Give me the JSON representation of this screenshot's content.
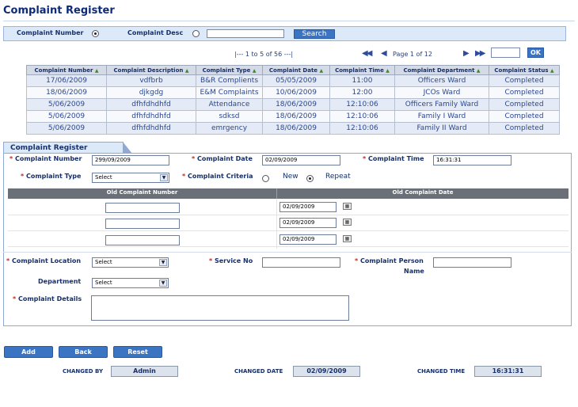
{
  "page": {
    "title": "Complaint Register"
  },
  "search": {
    "label_number": "Complaint Number",
    "label_desc": "Complaint Desc",
    "selected": "number",
    "input_value": "",
    "button_label": "Search"
  },
  "pager": {
    "range_text": "|--- 1    to    5    of    56 ---|",
    "first_icon": "first-page-icon",
    "prev_icon": "prev-page-icon",
    "page_text": "Page 1 of 12",
    "next_icon": "next-page-icon",
    "last_icon": "last-page-icon",
    "goto_value": "",
    "ok_label": "OK"
  },
  "grid": {
    "columns": [
      "Complaint Number",
      "Complaint Description",
      "Complaint Type",
      "Complaint Date",
      "Complaint Time",
      "Complaint Department",
      "Complaint Status"
    ],
    "rows": [
      [
        "17/06/2009",
        "vdfbrb",
        "B&R Complients",
        "05/05/2009",
        "11:00",
        "Officers Ward",
        "Completed"
      ],
      [
        "18/06/2009",
        "djkgdg",
        "E&M Complaints",
        "10/06/2009",
        "12:00",
        "JCOs Ward",
        "Completed"
      ],
      [
        "5/06/2009",
        "dfhfdhdhfd",
        "Attendance",
        "18/06/2009",
        "12:10:06",
        "Officers Family Ward",
        "Completed"
      ],
      [
        "5/06/2009",
        "dfhfdhdhfd",
        "sdksd",
        "18/06/2009",
        "12:10:06",
        "Family I Ward",
        "Completed"
      ],
      [
        "5/06/2009",
        "dfhfdhdhfd",
        "emrgency",
        "18/06/2009",
        "12:10:06",
        "Family II Ward",
        "Completed"
      ]
    ]
  },
  "form": {
    "tab_label": "Complaint Register",
    "complaint_number_label": "Complaint Number",
    "complaint_number_value": "299/09/2009",
    "complaint_date_label": "Complaint Date",
    "complaint_date_value": "02/09/2009",
    "complaint_time_label": "Complaint Time",
    "complaint_time_value": "16:31:31",
    "complaint_type_label": "Complaint Type",
    "complaint_type_value": "Select",
    "criteria_label": "Complaint Criteria",
    "criteria_new": "New",
    "criteria_repeat": "Repeat",
    "criteria_selected": "repeat",
    "old_number_header": "Old Complaint Number",
    "old_date_header": "Old Complaint Date",
    "old_rows": [
      {
        "number": "",
        "date": "02/09/2009"
      },
      {
        "number": "",
        "date": "02/09/2009"
      },
      {
        "number": "",
        "date": "02/09/2009"
      }
    ],
    "location_label": "Complaint Location",
    "location_value": "Select",
    "service_no_label": "Service No",
    "service_no_value": "",
    "person_name_label_1": "Complaint Person",
    "person_name_label_2": "Name",
    "person_name_value": "",
    "department_label": "Department",
    "department_value": "Select",
    "details_label": "Complaint Details",
    "details_value": ""
  },
  "actions": {
    "add": "Add",
    "back": "Back",
    "reset": "Reset"
  },
  "info": {
    "changed_by_label": "CHANGED BY",
    "changed_by_value": "Admin",
    "changed_date_label": "CHANGED DATE",
    "changed_date_value": "02/09/2009",
    "changed_time_label": "CHANGED TIME",
    "changed_time_value": "16:31:31"
  }
}
